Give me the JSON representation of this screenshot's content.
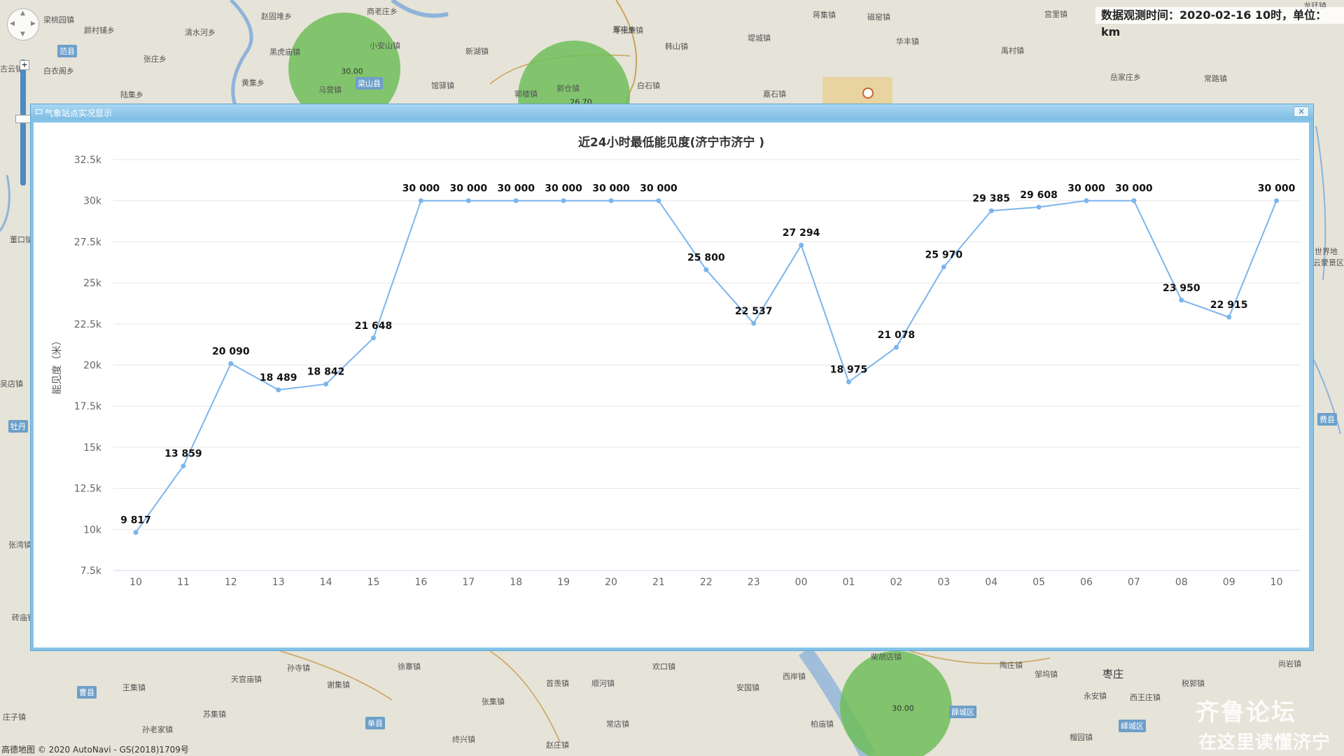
{
  "map": {
    "observe_time": "数据观测时间：2020-02-16 10时，单位：km",
    "copyright": "高德地图 © 2020 AutoNavi - GS(2018)1709号",
    "watermark": "齐鲁论坛",
    "watermark_sub": "在这里读懂济宁",
    "circles": [
      {
        "value": "30.00"
      },
      {
        "value": "26.70"
      },
      {
        "value": "30.00"
      }
    ],
    "labels": [
      {
        "text": "梁桃园镇",
        "type": "town"
      },
      {
        "text": "颜村铺乡",
        "type": "town"
      },
      {
        "text": "清水河乡",
        "type": "town"
      },
      {
        "text": "赵固堆乡",
        "type": "town"
      },
      {
        "text": "商老庄乡",
        "type": "town"
      },
      {
        "text": "范县",
        "type": "county"
      },
      {
        "text": "张庄乡",
        "type": "town"
      },
      {
        "text": "古云镇",
        "type": "town"
      },
      {
        "text": "白衣阁乡",
        "type": "town"
      },
      {
        "text": "黑虎庙镇",
        "type": "town"
      },
      {
        "text": "小安山镇",
        "type": "town"
      },
      {
        "text": "新湖镇",
        "type": "town"
      },
      {
        "text": "寿张集镇",
        "type": "town"
      },
      {
        "text": "黄集乡",
        "type": "town"
      },
      {
        "text": "马营镇",
        "type": "town"
      },
      {
        "text": "梁山县",
        "type": "county"
      },
      {
        "text": "馆驿镇",
        "type": "town"
      },
      {
        "text": "郭楼镇",
        "type": "town"
      },
      {
        "text": "郭仓镇",
        "type": "town"
      },
      {
        "text": "白石镇",
        "type": "town"
      },
      {
        "text": "嘉石镇",
        "type": "town"
      },
      {
        "text": "陆集乡",
        "type": "town"
      },
      {
        "text": "军屯乡",
        "type": "town"
      },
      {
        "text": "韩山镇",
        "type": "town"
      },
      {
        "text": "堤城镇",
        "type": "town"
      },
      {
        "text": "华丰镇",
        "type": "town"
      },
      {
        "text": "蒋集镇",
        "type": "town"
      },
      {
        "text": "磁窑镇",
        "type": "town"
      },
      {
        "text": "宫里镇",
        "type": "town"
      },
      {
        "text": "禹村镇",
        "type": "town"
      },
      {
        "text": "龙廷镇",
        "type": "town"
      },
      {
        "text": "岳家庄乡",
        "type": "town"
      },
      {
        "text": "常路镇",
        "type": "town"
      },
      {
        "text": "董口镇",
        "type": "town"
      },
      {
        "text": "吴店镇",
        "type": "town"
      },
      {
        "text": "牡丹",
        "type": "county"
      },
      {
        "text": "张湾镇",
        "type": "town"
      },
      {
        "text": "砖庙镇",
        "type": "town"
      },
      {
        "text": "费县",
        "type": "county"
      },
      {
        "text": "世界地",
        "type": "town"
      },
      {
        "text": "云蒙景区",
        "type": "town"
      },
      {
        "text": "孙寺镇",
        "type": "town"
      },
      {
        "text": "徐寨镇",
        "type": "town"
      },
      {
        "text": "欢口镇",
        "type": "town"
      },
      {
        "text": "柴胡店镇",
        "type": "town"
      },
      {
        "text": "陶庄镇",
        "type": "town"
      },
      {
        "text": "尚岩镇",
        "type": "town"
      },
      {
        "text": "曹县",
        "type": "county"
      },
      {
        "text": "王集镇",
        "type": "town"
      },
      {
        "text": "天宫庙镇",
        "type": "town"
      },
      {
        "text": "谢集镇",
        "type": "town"
      },
      {
        "text": "首羡镇",
        "type": "town"
      },
      {
        "text": "顺河镇",
        "type": "town"
      },
      {
        "text": "安国镇",
        "type": "town"
      },
      {
        "text": "西岸镇",
        "type": "town"
      },
      {
        "text": "枣庄",
        "type": "city"
      },
      {
        "text": "邹坞镇",
        "type": "town"
      },
      {
        "text": "税郭镇",
        "type": "town"
      },
      {
        "text": "苏集镇",
        "type": "town"
      },
      {
        "text": "张集镇",
        "type": "town"
      },
      {
        "text": "单县",
        "type": "county"
      },
      {
        "text": "常店镇",
        "type": "town"
      },
      {
        "text": "永安镇",
        "type": "town"
      },
      {
        "text": "西王庄镇",
        "type": "town"
      },
      {
        "text": "薛城区",
        "type": "county"
      },
      {
        "text": "孙老家镇",
        "type": "town"
      },
      {
        "text": "峄城区",
        "type": "county"
      },
      {
        "text": "庄子镇",
        "type": "town"
      },
      {
        "text": "终兴镇",
        "type": "town"
      },
      {
        "text": "赵庄镇",
        "type": "town"
      },
      {
        "text": "柏庙镇",
        "type": "town"
      },
      {
        "text": "榴园镇",
        "type": "town"
      }
    ]
  },
  "popup": {
    "title": "气象站点实况显示",
    "close_label": "×"
  },
  "chart_data": {
    "type": "line",
    "title": "近24小时最低能见度(济宁市济宁 )",
    "xlabel": "",
    "ylabel": "能见度（米）",
    "categories": [
      "10",
      "11",
      "12",
      "13",
      "14",
      "15",
      "16",
      "17",
      "18",
      "19",
      "20",
      "21",
      "22",
      "23",
      "00",
      "01",
      "02",
      "03",
      "04",
      "05",
      "06",
      "07",
      "08",
      "09",
      "10"
    ],
    "values": [
      9817,
      13859,
      20090,
      18489,
      18842,
      21648,
      30000,
      30000,
      30000,
      30000,
      30000,
      30000,
      25800,
      22537,
      27294,
      18975,
      21078,
      25970,
      29385,
      29608,
      30000,
      30000,
      23950,
      22915,
      30000
    ],
    "data_labels": [
      "9 817",
      "13 859",
      "20 090",
      "18 489",
      "18 842",
      "21 648",
      "30 000",
      "30 000",
      "30 000",
      "30 000",
      "30 000",
      "30 000",
      "25 800",
      "22 537",
      "27 294",
      "18 975",
      "21 078",
      "25 970",
      "29 385",
      "29 608",
      "30 000",
      "30 000",
      "23 950",
      "22 915",
      "30 000"
    ],
    "y_ticks": [
      {
        "value": 7500,
        "label": "7.5k"
      },
      {
        "value": 10000,
        "label": "10k"
      },
      {
        "value": 12500,
        "label": "12.5k"
      },
      {
        "value": 15000,
        "label": "15k"
      },
      {
        "value": 17500,
        "label": "17.5k"
      },
      {
        "value": 20000,
        "label": "20k"
      },
      {
        "value": 22500,
        "label": "22.5k"
      },
      {
        "value": 25000,
        "label": "25k"
      },
      {
        "value": 27500,
        "label": "27.5k"
      },
      {
        "value": 30000,
        "label": "30k"
      },
      {
        "value": 32500,
        "label": "32.5k"
      }
    ],
    "ylim": [
      7500,
      32500
    ],
    "grid": true,
    "colors": {
      "line": "#7cb5ec",
      "grid": "#e6e6e6",
      "axis": "#ccd6eb"
    }
  }
}
